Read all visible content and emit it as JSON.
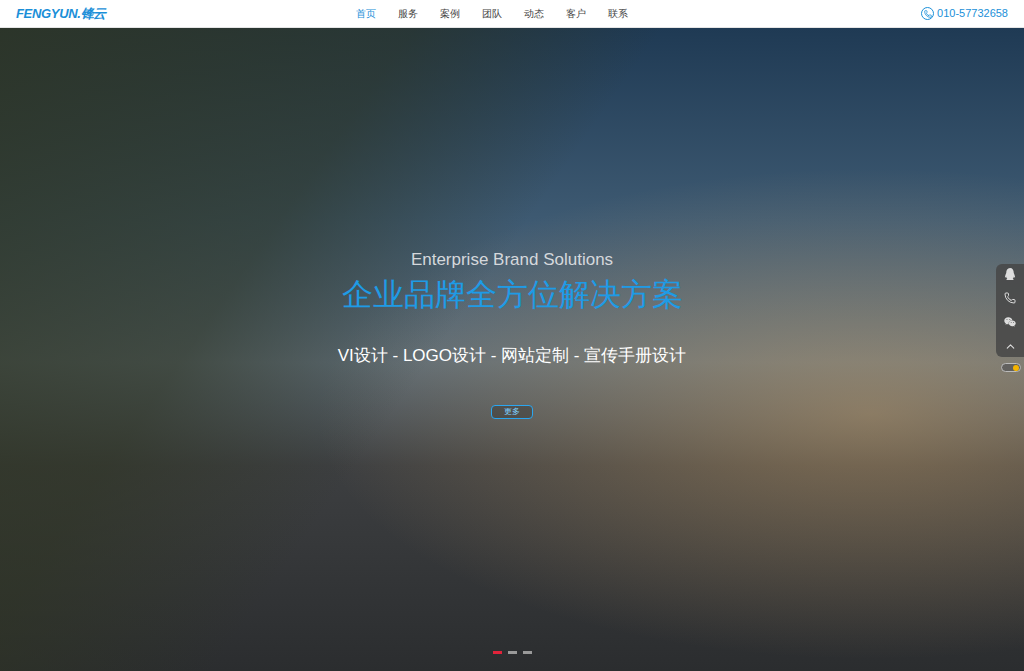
{
  "logo": {
    "text": "FENGYUN.锋云"
  },
  "nav": [
    {
      "label": "首页",
      "selected": true
    },
    {
      "label": "服务",
      "selected": false
    },
    {
      "label": "案例",
      "selected": false
    },
    {
      "label": "团队",
      "selected": false
    },
    {
      "label": "动态",
      "selected": false
    },
    {
      "label": "客户",
      "selected": false
    },
    {
      "label": "联系",
      "selected": false
    }
  ],
  "phone": "010-57732658",
  "hero": {
    "subtitle": "Enterprise Brand Solutions",
    "title": "企业品牌全方位解决方案",
    "services": "VI设计 - LOGO设计 - 网站定制 - 宣传手册设计",
    "button": "更多"
  },
  "slides": [
    {
      "selected": true
    },
    {
      "selected": false
    },
    {
      "selected": false
    }
  ],
  "side_toggle": {
    "on": true
  }
}
